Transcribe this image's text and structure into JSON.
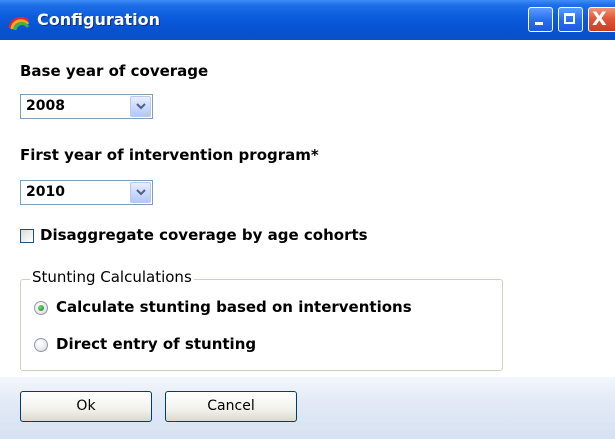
{
  "window": {
    "title": "Configuration",
    "minimize_icon": "minimize-icon",
    "maximize_icon": "maximize-icon",
    "close_icon": "close-icon",
    "close_glyph": "X"
  },
  "base_year": {
    "label": "Base year of coverage",
    "selected": "2008"
  },
  "first_year": {
    "label": "First year of intervention program*",
    "selected": "2010"
  },
  "disaggregate": {
    "label": "Disaggregate coverage by age cohorts",
    "checked": false
  },
  "stunting": {
    "legend": "Stunting Calculations",
    "options": [
      {
        "label": "Calculate stunting based on interventions",
        "selected": true
      },
      {
        "label": "Direct entry of stunting",
        "selected": false
      }
    ]
  },
  "buttons": {
    "ok": "Ok",
    "cancel": "Cancel"
  },
  "colors": {
    "titlebar": "#0752d1",
    "footer": "#e3eaf6",
    "radio_dot": "#2f9e2f"
  }
}
